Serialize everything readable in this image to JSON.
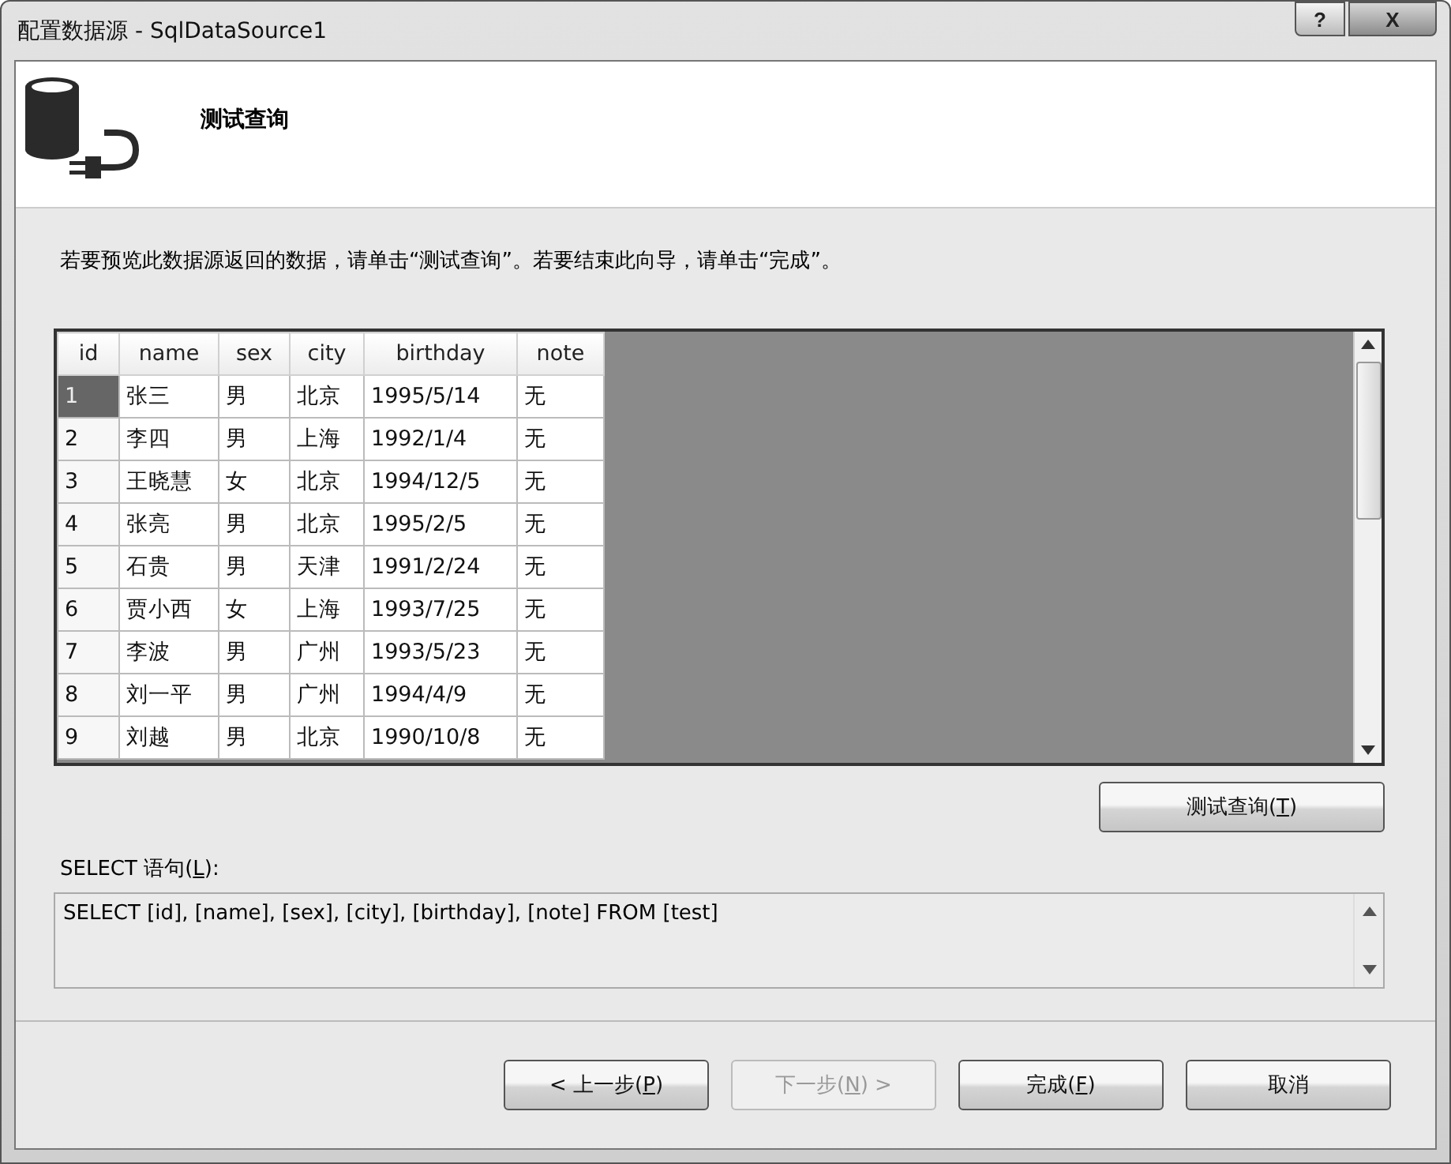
{
  "window": {
    "title": "配置数据源 - SqlDataSource1",
    "help_glyph": "?",
    "close_glyph": "X"
  },
  "header": {
    "title": "测试查询"
  },
  "instruction": "若要预览此数据源返回的数据，请单击“测试查询”。若要结束此向导，请单击“完成”。",
  "table": {
    "columns": [
      "id",
      "name",
      "sex",
      "city",
      "birthday",
      "note"
    ],
    "rows": [
      {
        "selected": true,
        "cells": [
          "1",
          "张三",
          "男",
          "北京",
          "1995/5/14",
          "无"
        ]
      },
      {
        "selected": false,
        "cells": [
          "2",
          "李四",
          "男",
          "上海",
          "1992/1/4",
          "无"
        ]
      },
      {
        "selected": false,
        "cells": [
          "3",
          "王晓慧",
          "女",
          "北京",
          "1994/12/5",
          "无"
        ]
      },
      {
        "selected": false,
        "cells": [
          "4",
          "张亮",
          "男",
          "北京",
          "1995/2/5",
          "无"
        ]
      },
      {
        "selected": false,
        "cells": [
          "5",
          "石贵",
          "男",
          "天津",
          "1991/2/24",
          "无"
        ]
      },
      {
        "selected": false,
        "cells": [
          "6",
          "贾小西",
          "女",
          "上海",
          "1993/7/25",
          "无"
        ]
      },
      {
        "selected": false,
        "cells": [
          "7",
          "李波",
          "男",
          "广州",
          "1993/5/23",
          "无"
        ]
      },
      {
        "selected": false,
        "cells": [
          "8",
          "刘一平",
          "男",
          "广州",
          "1994/4/9",
          "无"
        ]
      },
      {
        "selected": false,
        "cells": [
          "9",
          "刘越",
          "男",
          "北京",
          "1990/10/8",
          "无"
        ]
      }
    ]
  },
  "test_button": {
    "before": "测试查询(",
    "key": "T",
    "after": ")",
    "disabled": false
  },
  "select_label": {
    "before": "SELECT 语句(",
    "key": "L",
    "after": "):"
  },
  "select_statement": "SELECT [id], [name], [sex], [city], [birthday], [note] FROM [test]",
  "buttons": [
    {
      "before": "< 上一步(",
      "key": "P",
      "after": ")",
      "disabled": false
    },
    {
      "before": "下一步(",
      "key": "N",
      "after": ") >",
      "disabled": true
    },
    {
      "before": "完成(",
      "key": "F",
      "after": ")",
      "disabled": false
    },
    {
      "before": "取消",
      "disabled": false
    }
  ]
}
